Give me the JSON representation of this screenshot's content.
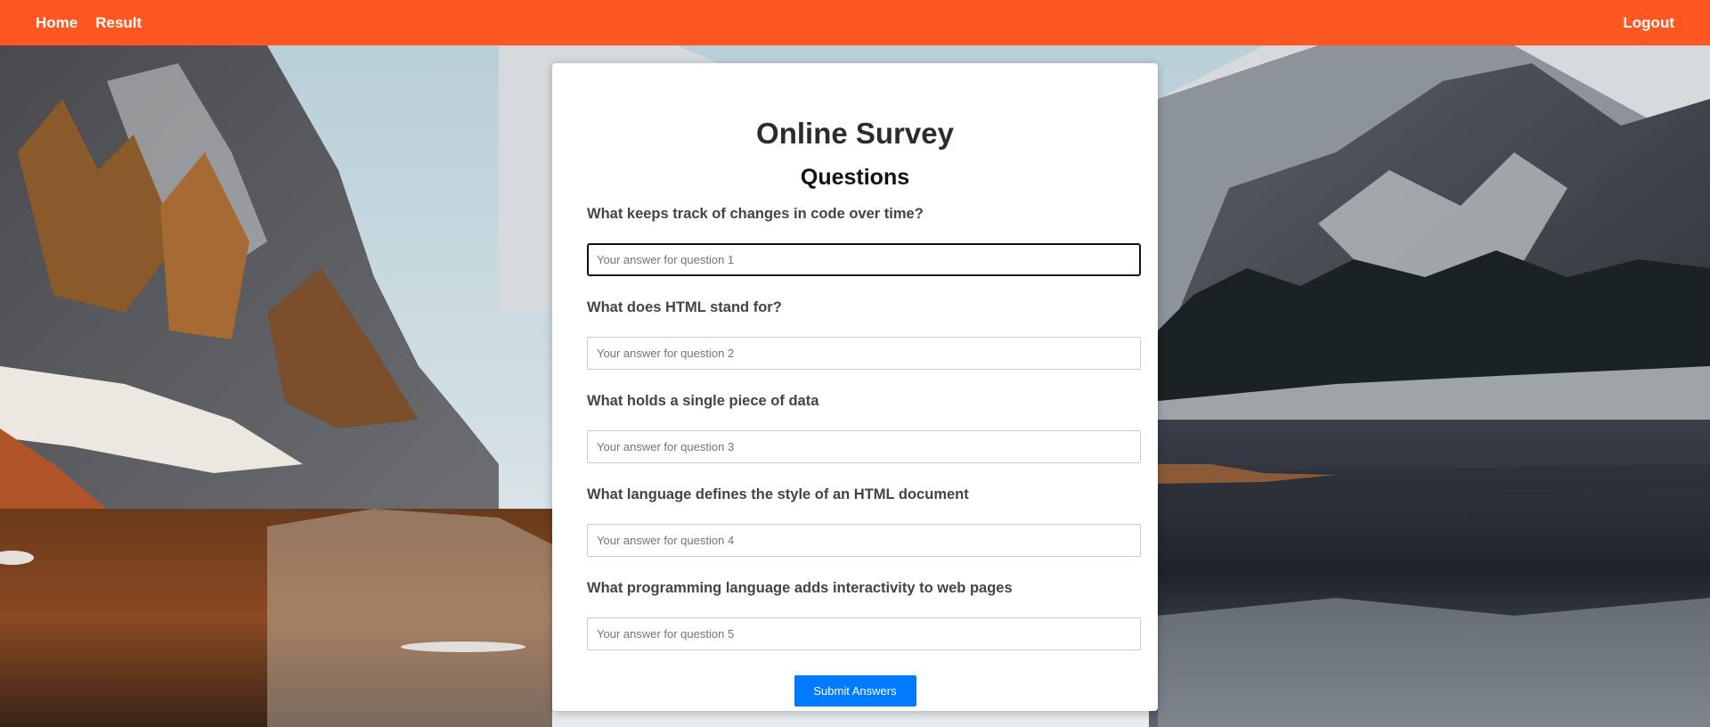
{
  "nav": {
    "links": [
      "Home",
      "Result"
    ],
    "logout": "Logout",
    "bg_color": "#ff5722"
  },
  "survey": {
    "title": "Online Survey",
    "subtitle": "Questions",
    "questions": [
      {
        "label": "What keeps track of changes in code over time?",
        "placeholder": "Your answer for question 1",
        "value": ""
      },
      {
        "label": "What does HTML stand for?",
        "placeholder": "Your answer for question 2",
        "value": ""
      },
      {
        "label": "What holds a single piece of data",
        "placeholder": "Your answer for question 3",
        "value": ""
      },
      {
        "label": "What language defines the style of an HTML document",
        "placeholder": "Your answer for question 4",
        "value": ""
      },
      {
        "label": "What programming language adds interactivity to web pages",
        "placeholder": "Your answer for question 5",
        "value": ""
      }
    ],
    "submit_label": "Submit Answers",
    "submit_color": "#007bff"
  }
}
